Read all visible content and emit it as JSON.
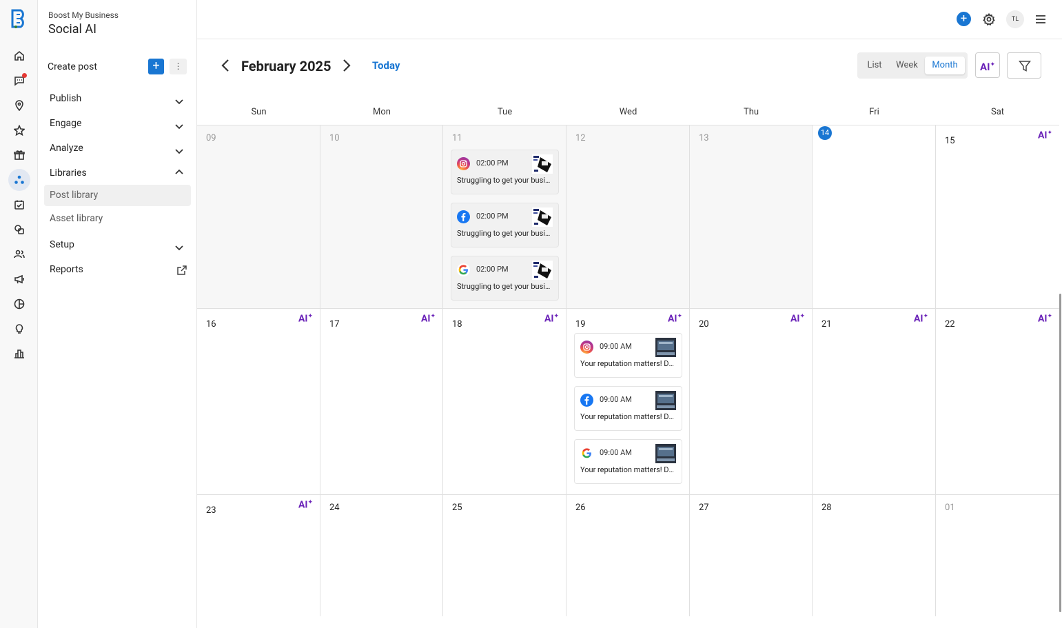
{
  "brand": {
    "business_name": "Boost My Business",
    "app_name": "Social AI",
    "accent": "#1976d2",
    "ai_color": "#6a22b8"
  },
  "rail": {
    "icons": [
      "home-icon",
      "messages-icon",
      "location-icon",
      "star-icon",
      "gift-icon",
      "social-icon",
      "tasks-icon",
      "chat-icon",
      "contacts-icon",
      "megaphone-icon",
      "chart-pie-icon",
      "lightbulb-icon",
      "bar-chart-icon"
    ]
  },
  "nav": {
    "create_post": "Create post",
    "sections": {
      "publish": "Publish",
      "engage": "Engage",
      "analyze": "Analyze",
      "libraries": "Libraries",
      "setup": "Setup",
      "reports": "Reports"
    },
    "library_items": {
      "post_library": "Post library",
      "asset_library": "Asset library"
    }
  },
  "topbar": {
    "avatar_initials": "TL"
  },
  "calendar": {
    "month_title": "February 2025",
    "today_label": "Today",
    "views": {
      "list": "List",
      "week": "Week",
      "month": "Month"
    },
    "selected_view": "Month",
    "ai_label": "AI",
    "weekdays": [
      "Sun",
      "Mon",
      "Tue",
      "Wed",
      "Thu",
      "Fri",
      "Sat"
    ],
    "weeks": [
      [
        "09",
        "10",
        "11",
        "12",
        "13",
        "14",
        "15"
      ],
      [
        "16",
        "17",
        "18",
        "19",
        "20",
        "21",
        "22"
      ],
      [
        "23",
        "24",
        "25",
        "26",
        "27",
        "28",
        "01"
      ]
    ],
    "today_day": "14",
    "posts_tue_11": [
      {
        "platform": "instagram",
        "time": "02:00 PM",
        "text": "Struggling to get your business noticed online?"
      },
      {
        "platform": "facebook",
        "time": "02:00 PM",
        "text": "Struggling to get your business noticed online?"
      },
      {
        "platform": "google",
        "time": "02:00 PM",
        "text": "Struggling to get your business noticed online?"
      }
    ],
    "posts_wed_19": [
      {
        "platform": "instagram",
        "time": "09:00 AM",
        "text": "Your reputation matters! Don't let negative reviews hold you back."
      },
      {
        "platform": "facebook",
        "time": "09:00 AM",
        "text": "Your reputation matters! Don't let negative reviews hold you back."
      },
      {
        "platform": "google",
        "time": "09:00 AM",
        "text": "Your reputation matters! Don't let negative reviews hold you back."
      }
    ]
  }
}
